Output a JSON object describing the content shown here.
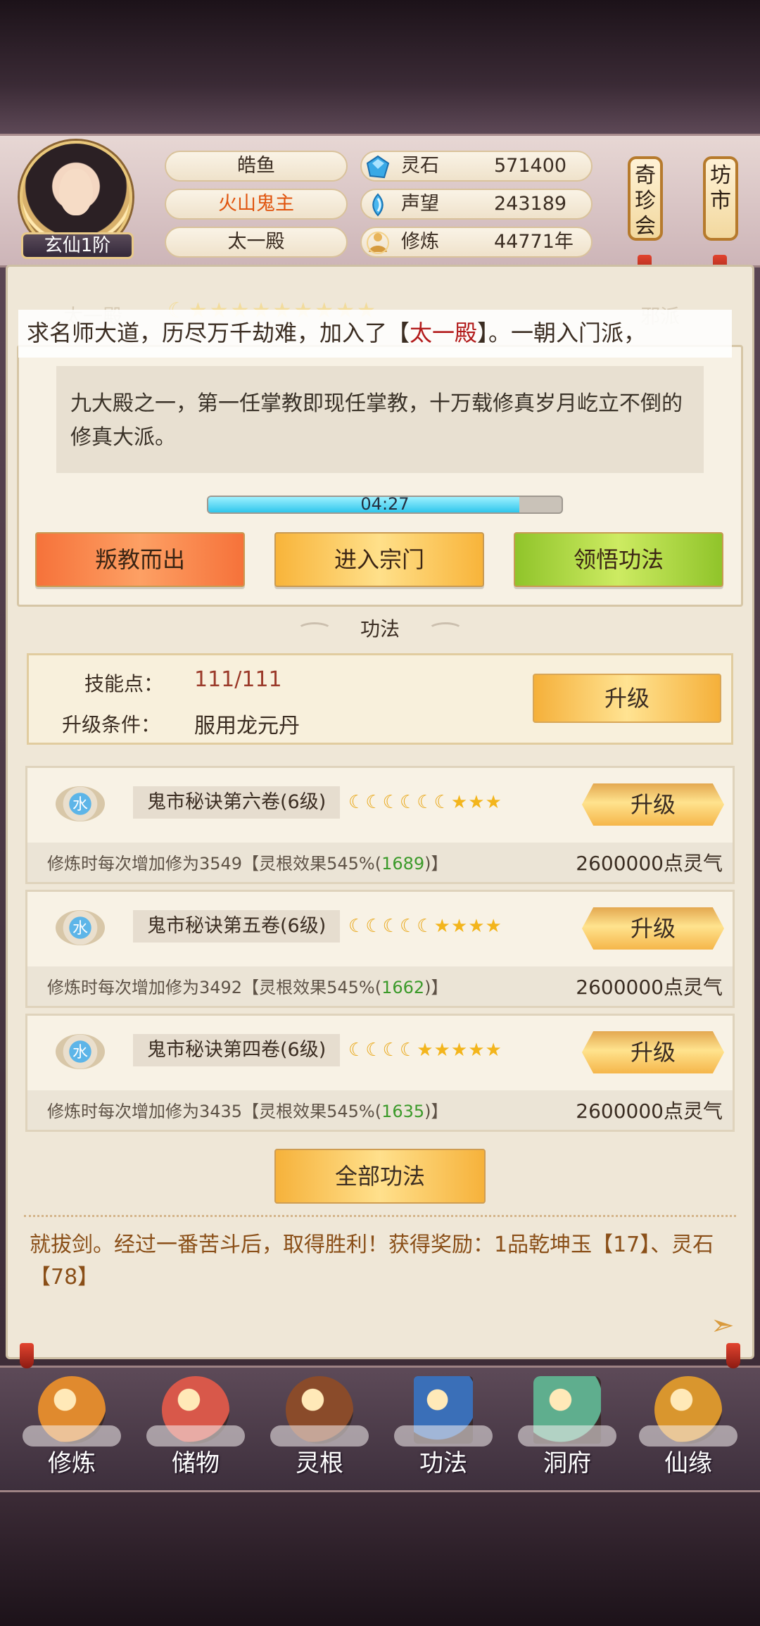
{
  "player": {
    "name": "皓鱼",
    "title": "火山鬼主",
    "sect": "太一殿",
    "rank": "玄仙1阶"
  },
  "resources": [
    {
      "icon": "spirit-stone-icon",
      "label": "灵石",
      "value": "571400"
    },
    {
      "icon": "prestige-icon",
      "label": "声望",
      "value": "243189"
    },
    {
      "icon": "cultivation-icon",
      "label": "修炼",
      "value": "44771年"
    }
  ],
  "shop_tags": {
    "treasure": "奇珍会",
    "market": "坊市"
  },
  "sect_panel": {
    "left_ghost": "太一殿",
    "right_ghost": "邪派",
    "ticker_pre": "求名师大道，历尽万千劫难，加入了【",
    "ticker_sect": "太一殿",
    "ticker_post": "】。一朝入门派，",
    "description": "九大殿之一，第一任掌教即现任掌教，十万载修真岁月屹立不倒的修真大派。",
    "timer": "04:27",
    "timer_progress": 0.88,
    "buttons": [
      "叛教而出",
      "进入宗门",
      "领悟功法"
    ]
  },
  "section_title": "功法",
  "skill_points": {
    "label": "技能点：",
    "value": "111/111",
    "cond_label": "升级条件：",
    "cond_value": "服用龙元丹",
    "upgrade": "升级"
  },
  "techniques": [
    {
      "element": "水",
      "name": "鬼市秘诀第六卷(6级)",
      "moons": 6,
      "stars": 3,
      "upgrade": "升级",
      "desc_pre": "修炼时每次增加修为3549【灵根效果545%(",
      "desc_bonus": "1689",
      "desc_post": ")】",
      "cost": "2600000点灵气"
    },
    {
      "element": "水",
      "name": "鬼市秘诀第五卷(6级)",
      "moons": 5,
      "stars": 4,
      "upgrade": "升级",
      "desc_pre": "修炼时每次增加修为3492【灵根效果545%(",
      "desc_bonus": "1662",
      "desc_post": ")】",
      "cost": "2600000点灵气"
    },
    {
      "element": "水",
      "name": "鬼市秘诀第四卷(6级)",
      "moons": 4,
      "stars": 5,
      "upgrade": "升级",
      "desc_pre": "修炼时每次增加修为3435【灵根效果545%(",
      "desc_bonus": "1635",
      "desc_post": ")】",
      "cost": "2600000点灵气"
    }
  ],
  "all_techniques_button": "全部功法",
  "log_text": "就拔剑。经过一番苦斗后，取得胜利！获得奖励：1品乾坤玉【17】、灵石【78】",
  "nav": [
    {
      "label": "修炼",
      "icon": "meditating-monk-icon",
      "color": "#e08a2e"
    },
    {
      "label": "储物",
      "icon": "storage-bag-icon",
      "color": "#d8584a"
    },
    {
      "label": "灵根",
      "icon": "spirit-root-icon",
      "color": "#8a4b2a"
    },
    {
      "label": "功法",
      "icon": "skill-book-icon",
      "color": "#3a6fb8"
    },
    {
      "label": "洞府",
      "icon": "cave-house-icon",
      "color": "#5fae8e"
    },
    {
      "label": "仙缘",
      "icon": "gourd-icon",
      "color": "#d9962e"
    }
  ]
}
